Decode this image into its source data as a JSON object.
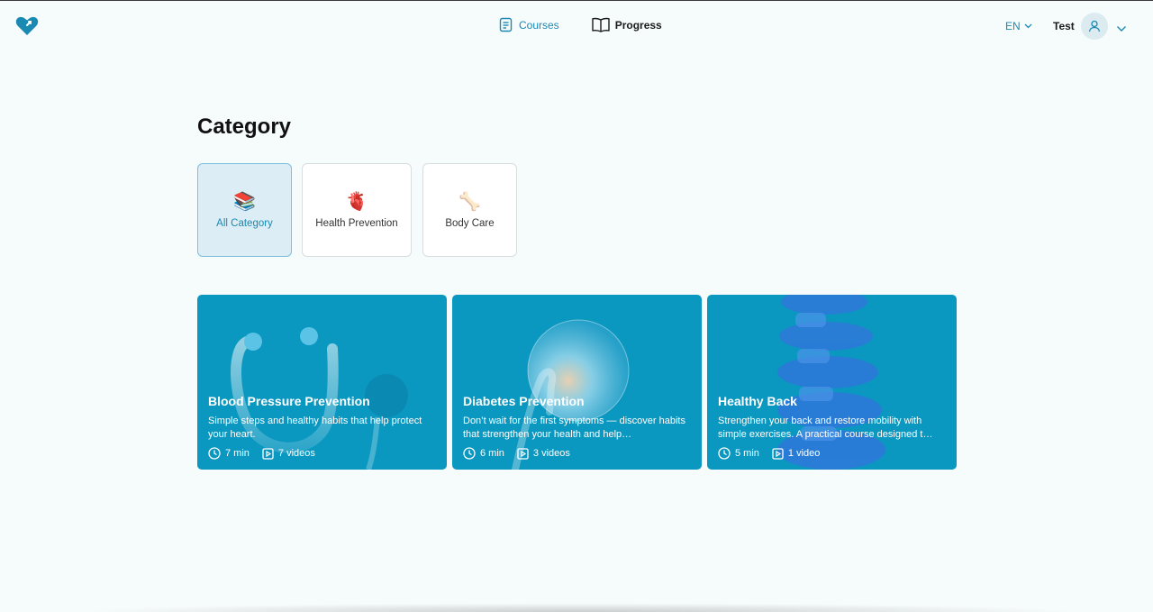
{
  "nav": {
    "courses_label": "Courses",
    "progress_label": "Progress"
  },
  "header": {
    "language": "EN",
    "username": "Test"
  },
  "page": {
    "title": "Category"
  },
  "categories": [
    {
      "label": "All Category",
      "icon": "📚",
      "active": true
    },
    {
      "label": "Health Prevention",
      "icon": "🫀",
      "active": false
    },
    {
      "label": "Body Care",
      "icon": "🦴",
      "active": false
    }
  ],
  "courses": [
    {
      "title": "Blood Pressure Prevention",
      "description": "Simple steps and healthy habits that help protect your heart.",
      "duration": "7 min",
      "videos": "7 videos"
    },
    {
      "title": "Diabetes Prevention",
      "description": "Don’t wait for the first symptoms — discover habits that strengthen your health and help…",
      "duration": "6 min",
      "videos": "3 videos"
    },
    {
      "title": "Healthy Back",
      "description": "Strengthen your back and restore mobility with simple exercises. A practical course designed t…",
      "duration": "5 min",
      "videos": "1 video"
    }
  ],
  "colors": {
    "accent": "#1a8ab3",
    "card_bg": "#0a97c0",
    "page_bg": "#f6fbfc"
  }
}
